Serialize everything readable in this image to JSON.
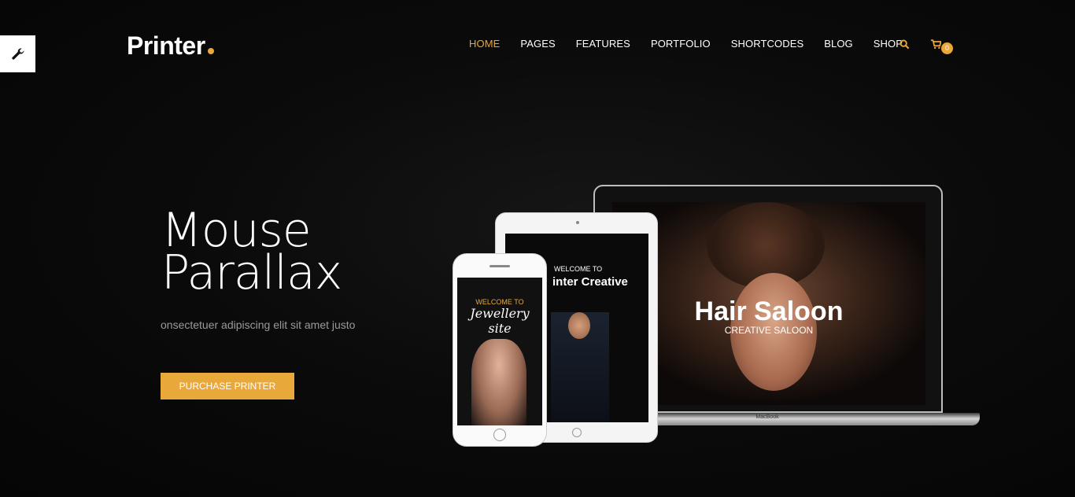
{
  "tool_button": {
    "icon": "wrench-icon"
  },
  "header": {
    "logo": "Printer",
    "accent_color": "#e9a83a"
  },
  "nav": {
    "items": [
      {
        "label": "HOME",
        "active": true
      },
      {
        "label": "PAGES",
        "active": false
      },
      {
        "label": "FEATURES",
        "active": false
      },
      {
        "label": "PORTFOLIO",
        "active": false
      },
      {
        "label": "SHORTCODES",
        "active": false
      },
      {
        "label": "BLOG",
        "active": false
      },
      {
        "label": "SHOP",
        "active": false
      }
    ],
    "search_icon": "search-icon",
    "cart_icon": "cart-icon",
    "cart_count": "0"
  },
  "hero": {
    "title": "Mouse\nParallax",
    "subtitle": "onsectetuer adipiscing elit sit amet justo",
    "cta_label": "PURCHASE PRINTER"
  },
  "devices": {
    "laptop": {
      "title": "Hair Saloon",
      "subtitle": "CREATIVE SALOON",
      "label": "MacBook"
    },
    "tablet": {
      "welcome": "WELCOME TO",
      "heading": "inter Creative"
    },
    "phone": {
      "welcome": "WELCOME TO",
      "script": "Jewellery site"
    }
  }
}
